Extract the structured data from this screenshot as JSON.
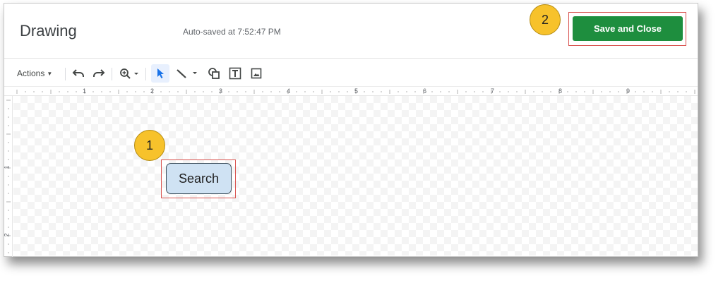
{
  "header": {
    "title": "Drawing",
    "autosave_text": "Auto-saved at 7:52:47 PM",
    "save_button_label": "Save and Close",
    "save_button_color": "#1e8e3e"
  },
  "toolbar": {
    "actions_label": "Actions",
    "icons": [
      "undo-icon",
      "redo-icon",
      "zoom-icon",
      "select-icon",
      "line-icon",
      "shape-icon",
      "text-box-icon",
      "image-icon"
    ]
  },
  "ruler": {
    "horizontal_numbers": [
      "1",
      "2",
      "3",
      "4",
      "5",
      "6",
      "7",
      "8",
      "9"
    ],
    "vertical_numbers": [
      "1",
      "2"
    ]
  },
  "canvas": {
    "shape_label": "Search",
    "shape_fill": "#cfe2f3"
  },
  "callouts": {
    "first": "1",
    "second": "2",
    "color": "#f7c22b",
    "highlight_color": "#d9534f"
  }
}
